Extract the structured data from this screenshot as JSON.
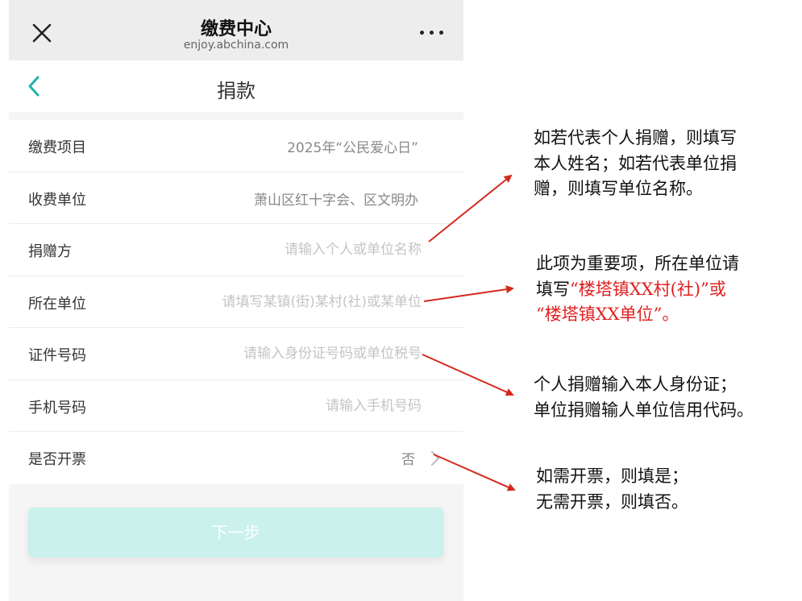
{
  "topbar": {
    "title": "缴费中心",
    "url": "enjoy.abchina.com",
    "close_icon": "close-icon",
    "more_icon": "more-dots-icon"
  },
  "navbar": {
    "title": "捐款",
    "back_icon": "chevron-left-icon"
  },
  "form": {
    "item": {
      "label": "缴费项目",
      "value": "2025年“公民爱心日”"
    },
    "payee": {
      "label": "收费单位",
      "value": "萧山区红十字会、区文明办"
    },
    "donor": {
      "label": "捐赠方",
      "placeholder": "请输入个人或单位名称"
    },
    "unit": {
      "label": "所在单位",
      "placeholder": "请填写某镇(街)某村(社)或某单位"
    },
    "id_number": {
      "label": "证件号码",
      "placeholder": "请输入身份证号码或单位税号"
    },
    "phone": {
      "label": "手机号码",
      "placeholder": "请输入手机号码"
    },
    "invoice": {
      "label": "是否开票",
      "value": "否"
    }
  },
  "next_button": {
    "label": "下一步"
  },
  "annotations": {
    "donor": {
      "line1": "如若代表个人捐赠，则填写",
      "line2": "本人姓名；如若代表单位捐",
      "line3": "赠，则填写单位名称。"
    },
    "unit": {
      "line1": "此项为重要项，所在单位请",
      "line2_prefix": "填写",
      "line2_red": "“楼塔镇XX村(社)”或",
      "line3_red": "“楼塔镇XX单位”。"
    },
    "id_number": {
      "line1": "个人捐赠输入本人身份证；",
      "line2": "单位捐赠输人单位信用代码。"
    },
    "invoice": {
      "line1": "如需开票，则填是；",
      "line2": "无需开票，则填否。"
    }
  },
  "colors": {
    "accent": "#1bb6a7",
    "button_bg": "#cbf1ec",
    "annotation_red": "#e02020",
    "arrow_red": "#d42a1e"
  }
}
